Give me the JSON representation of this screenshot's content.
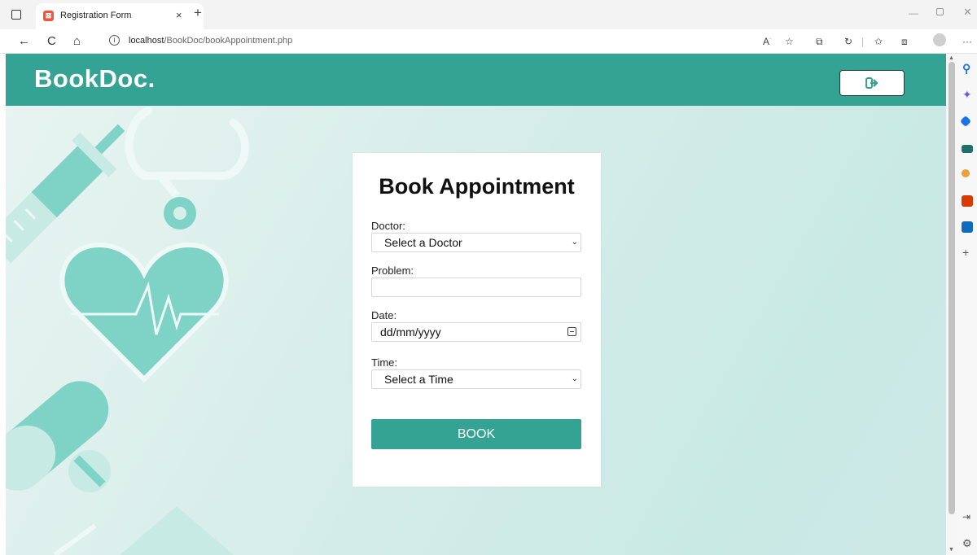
{
  "browser": {
    "tab_title": "Registration Form",
    "tab_close": "×",
    "new_tab": "+",
    "url_host": "localhost",
    "url_path": "/BookDoc/bookAppointment.php",
    "nav": {
      "back": "←",
      "refresh": "C",
      "home": "⌂"
    },
    "toolbar_icons": [
      "read-aloud-icon",
      "favorites-add-icon",
      "extension-icon",
      "copilot-icon",
      "favorites-icon",
      "collections-icon",
      "profile-icon",
      "more-icon"
    ],
    "more": "···",
    "win_min": "—",
    "win_close": "✕"
  },
  "site": {
    "logo": "BookDoc.",
    "logout_icon": "sign-out-icon"
  },
  "form": {
    "title": "Book Appointment",
    "doctor_label": "Doctor:",
    "doctor_value": "Select a Doctor",
    "problem_label": "Problem:",
    "problem_value": "",
    "date_label": "Date:",
    "date_placeholder": "dd/mm/yyyy",
    "time_label": "Time:",
    "time_value": "Select a Time",
    "submit": "BOOK"
  },
  "sidebar": {
    "icons": [
      "search-icon",
      "copilot-spark-icon",
      "shopping-tag-icon",
      "tools-icon",
      "games-icon",
      "office-icon",
      "outlook-icon"
    ],
    "add": "+",
    "colors": {
      "accent": "#34a394",
      "search": "#1a73e8",
      "office": "#d83b01",
      "outlook": "#0f6cbd"
    }
  }
}
